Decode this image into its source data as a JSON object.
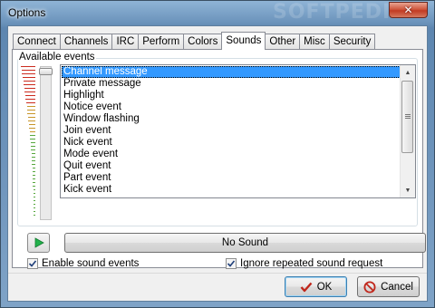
{
  "window": {
    "title": "Options",
    "watermark": "SOFTPEDIA",
    "close_glyph": "✕"
  },
  "tabs": [
    {
      "label": "Connect",
      "active": false
    },
    {
      "label": "Channels",
      "active": false
    },
    {
      "label": "IRC",
      "active": false
    },
    {
      "label": "Perform",
      "active": false
    },
    {
      "label": "Colors",
      "active": false
    },
    {
      "label": "Sounds",
      "active": true
    },
    {
      "label": "Other",
      "active": false
    },
    {
      "label": "Misc",
      "active": false
    },
    {
      "label": "Security",
      "active": false
    }
  ],
  "sounds": {
    "events_label": "Available events",
    "events": [
      "Channel message",
      "Private message",
      "Highlight",
      "Notice event",
      "Window flashing",
      "Join event",
      "Nick event",
      "Mode event",
      "Quit event",
      "Part event",
      "Kick event"
    ],
    "selected_index": 0,
    "selected_sound": "No Sound",
    "enable_sound_events": {
      "label": "Enable sound events",
      "checked": true
    },
    "ignore_repeated": {
      "label": "Ignore repeated sound request",
      "checked": true
    },
    "volume_level": 1.0
  },
  "buttons": {
    "ok": "OK",
    "cancel": "Cancel"
  },
  "colors": {
    "selection": "#3399ff",
    "play_green": "#22b14c",
    "vol_high": "#cc2a1e",
    "vol_low": "#58a83e"
  }
}
